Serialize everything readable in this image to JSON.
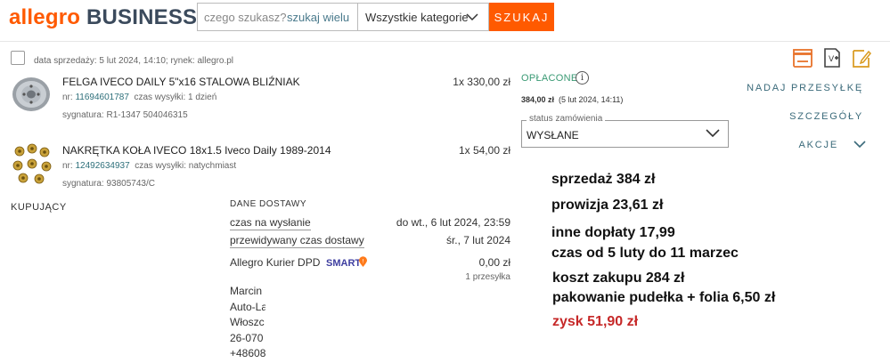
{
  "header": {
    "logo_part1": "allegro",
    "logo_part2": "BUSINESS",
    "search_placeholder": "czego szukasz?",
    "search_many": "szukaj wielu",
    "category": "Wszystkie kategorie",
    "search_button": "SZUKAJ"
  },
  "order": {
    "meta": "data sprzedaży:  5 lut 2024, 14:10; rynek: allegro.pl",
    "items": [
      {
        "title": "FELGA IVECO DAILY 5\"x16 STALOWA BLIŹNIAK",
        "nr_label": "nr:",
        "nr": "11694601787",
        "ship_label": "czas wysyłki:",
        "ship": "1 dzień",
        "signature": "sygnatura: R1-1347 504046315",
        "price": "1x 330,00 zł"
      },
      {
        "title": "NAKRĘTKA KOŁA IVECO 18x1.5 Iveco Daily 1989-2014",
        "nr_label": "nr:",
        "nr": "12492634937",
        "ship_label": "czas wysyłki:",
        "ship": "natychmiast",
        "signature": "sygnatura: 93805743/C",
        "price": "1x 54,00 zł"
      }
    ],
    "payment": {
      "status": "OPŁACONE",
      "amount": "384,00 zł",
      "date": "(5 lut 2024, 14:11)"
    },
    "order_status": {
      "label": "status zamówienia",
      "value": "WYSŁANE"
    },
    "actions": {
      "ship": "NADAJ PRZESYŁKĘ",
      "details": "SZCZEGÓŁY",
      "more": "AKCJE"
    }
  },
  "buyer": {
    "heading": "KUPUJĄCY"
  },
  "delivery": {
    "heading": "DANE DOSTAWY",
    "rows": [
      {
        "label": "czas na wysłanie",
        "value": "do wt., 6 lut 2024, 23:59"
      },
      {
        "label": "przewidywany czas dostawy",
        "value": "śr., 7 lut 2024"
      }
    ],
    "carrier": "Allegro Kurier DPD",
    "smart": "SMART",
    "carrier_price": "0,00 zł",
    "parcels": "1 przesyłka",
    "address": [
      "Marcin",
      "Auto-La",
      "Włoszc",
      "26-070",
      "+48608"
    ]
  },
  "notes": {
    "line1": "sprzedaż 384 zł",
    "line2": "prowizja 23,61 zł",
    "line3": "inne dopłaty 17,99",
    "line4": "czas od 5 luty do 11 marzec",
    "line5": "koszt zakupu 284 zł",
    "line6": "pakowanie pudełka + folia 6,50 zł",
    "line7": "zysk 51,90 zł"
  },
  "colors": {
    "brand": "#ff5a00",
    "paid": "#3a9a74",
    "link": "#2d6f7a",
    "profit": "#c62828"
  }
}
